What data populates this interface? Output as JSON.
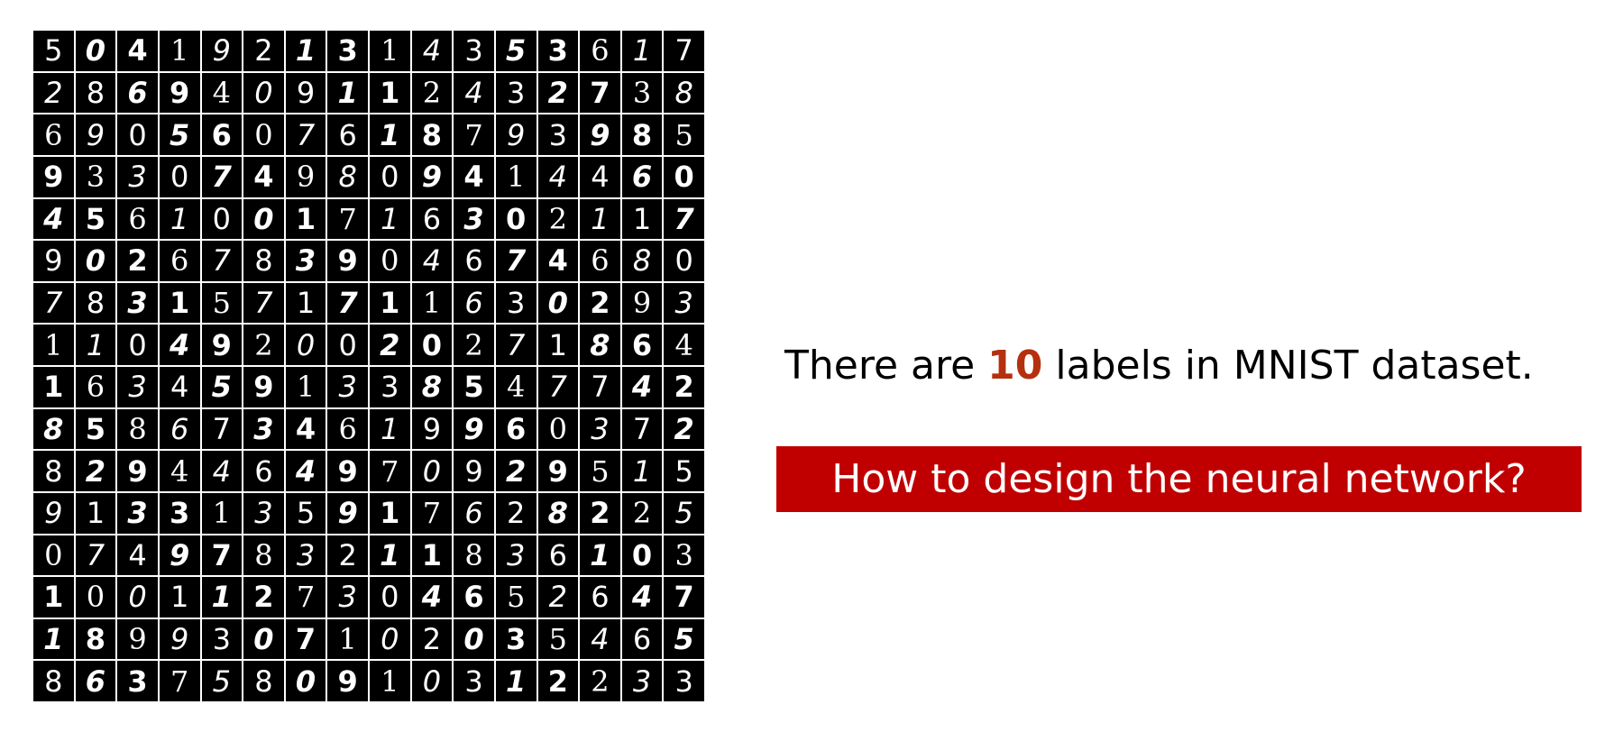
{
  "mnist_grid": {
    "rows": [
      [
        "5",
        "0",
        "4",
        "1",
        "9",
        "2",
        "1",
        "3",
        "1",
        "4",
        "3",
        "5",
        "3",
        "6",
        "1",
        "7"
      ],
      [
        "2",
        "8",
        "6",
        "9",
        "4",
        "0",
        "9",
        "1",
        "1",
        "2",
        "4",
        "3",
        "2",
        "7",
        "3",
        "8"
      ],
      [
        "6",
        "9",
        "0",
        "5",
        "6",
        "0",
        "7",
        "6",
        "1",
        "8",
        "7",
        "9",
        "3",
        "9",
        "8",
        "5"
      ],
      [
        "9",
        "3",
        "3",
        "0",
        "7",
        "4",
        "9",
        "8",
        "0",
        "9",
        "4",
        "1",
        "4",
        "4",
        "6",
        "0"
      ],
      [
        "4",
        "5",
        "6",
        "1",
        "0",
        "0",
        "1",
        "7",
        "1",
        "6",
        "3",
        "0",
        "2",
        "1",
        "1",
        "7"
      ],
      [
        "9",
        "0",
        "2",
        "6",
        "7",
        "8",
        "3",
        "9",
        "0",
        "4",
        "6",
        "7",
        "4",
        "6",
        "8",
        "0"
      ],
      [
        "7",
        "8",
        "3",
        "1",
        "5",
        "7",
        "1",
        "7",
        "1",
        "1",
        "6",
        "3",
        "0",
        "2",
        "9",
        "3"
      ],
      [
        "1",
        "1",
        "0",
        "4",
        "9",
        "2",
        "0",
        "0",
        "2",
        "0",
        "2",
        "7",
        "1",
        "8",
        "6",
        "4"
      ],
      [
        "1",
        "6",
        "3",
        "4",
        "5",
        "9",
        "1",
        "3",
        "3",
        "8",
        "5",
        "4",
        "7",
        "7",
        "4",
        "2"
      ],
      [
        "8",
        "5",
        "8",
        "6",
        "7",
        "3",
        "4",
        "6",
        "1",
        "9",
        "9",
        "6",
        "0",
        "3",
        "7",
        "2"
      ],
      [
        "8",
        "2",
        "9",
        "4",
        "4",
        "6",
        "4",
        "9",
        "7",
        "0",
        "9",
        "2",
        "9",
        "5",
        "1",
        "5"
      ],
      [
        "9",
        "1",
        "3",
        "3",
        "1",
        "3",
        "5",
        "9",
        "1",
        "7",
        "6",
        "2",
        "8",
        "2",
        "2",
        "5"
      ],
      [
        "0",
        "7",
        "4",
        "9",
        "7",
        "8",
        "3",
        "2",
        "1",
        "1",
        "8",
        "3",
        "6",
        "1",
        "0",
        "3"
      ],
      [
        "1",
        "0",
        "0",
        "1",
        "1",
        "2",
        "7",
        "3",
        "0",
        "4",
        "6",
        "5",
        "2",
        "6",
        "4",
        "7"
      ],
      [
        "1",
        "8",
        "9",
        "9",
        "3",
        "0",
        "7",
        "1",
        "0",
        "2",
        "0",
        "3",
        "5",
        "4",
        "6",
        "5"
      ],
      [
        "8",
        "6",
        "3",
        "7",
        "5",
        "8",
        "0",
        "9",
        "1",
        "0",
        "3",
        "1",
        "2",
        "2",
        "3",
        "3"
      ]
    ]
  },
  "statement": {
    "prefix": "There are ",
    "highlight": "10",
    "suffix": " labels in MNIST dataset."
  },
  "question": "How to design the neural network?",
  "colors": {
    "highlight": "#b5300f",
    "banner_background": "#c00000",
    "banner_text": "#ffffff",
    "grid_cell": "#000000",
    "digit": "#ffffff"
  }
}
